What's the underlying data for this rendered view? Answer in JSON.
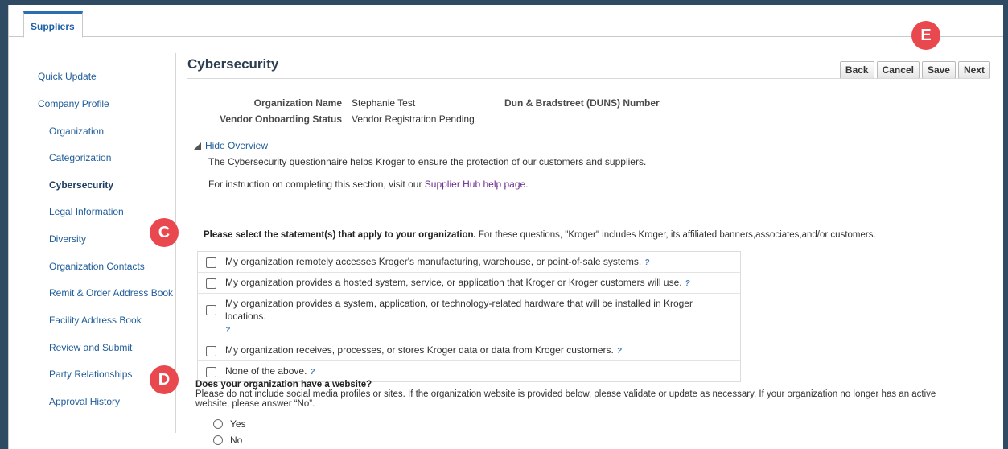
{
  "tabs": [
    {
      "label": "Suppliers"
    }
  ],
  "sidebar": {
    "items": [
      {
        "label": "Quick Update"
      },
      {
        "label": "Company Profile"
      },
      {
        "label": "Organization"
      },
      {
        "label": "Categorization"
      },
      {
        "label": "Cybersecurity"
      },
      {
        "label": "Legal Information"
      },
      {
        "label": "Diversity"
      },
      {
        "label": "Organization Contacts"
      },
      {
        "label": "Remit & Order Address Book"
      },
      {
        "label": "Facility Address Book"
      },
      {
        "label": "Review and Submit"
      },
      {
        "label": "Party Relationships"
      },
      {
        "label": "Approval History"
      }
    ],
    "active": "Cybersecurity"
  },
  "page": {
    "title": "Cybersecurity"
  },
  "buttons": {
    "back": "Back",
    "cancel": "Cancel",
    "save": "Save",
    "next": "Next"
  },
  "info": {
    "org_name_label": "Organization Name",
    "org_name_value": "Stephanie Test",
    "status_label": "Vendor Onboarding Status",
    "status_value": "Vendor Registration Pending",
    "duns_label": "Dun & Bradstreet (DUNS) Number"
  },
  "overview": {
    "toggle": "Hide Overview",
    "text1": "The Cybersecurity questionnaire helps Kroger to ensure the protection of our customers and suppliers.",
    "text2_prefix": "For instruction on completing this section, visit our ",
    "text2_link": "Supplier Hub help page",
    "text2_suffix": "."
  },
  "question": {
    "bold": "Please select the statement(s) that apply to your organization.",
    "rest": " For these questions, \"Kroger\" includes Kroger, its affiliated banners,associates,and/or customers."
  },
  "statements": [
    {
      "label": "My organization remotely accesses Kroger's manufacturing, warehouse, or point-of-sale systems."
    },
    {
      "label": "My organization provides a hosted system, service, or application that Kroger or Kroger customers will use."
    },
    {
      "label": "My organization provides a system, application, or technology-related hardware that will be installed in Kroger locations."
    },
    {
      "label": "My organization receives, processes, or stores Kroger data or data from Kroger customers."
    },
    {
      "label": "None of the above."
    }
  ],
  "website_question": {
    "title": "Does your organization have a website?",
    "desc": "Please do not include social media profiles or sites. If the organization website is provided below, please validate or update as necessary. If your organization no longer has an active website, please answer “No”.",
    "options": [
      {
        "label": "Yes"
      },
      {
        "label": "No"
      }
    ]
  },
  "markers": {
    "c": "C",
    "d": "D",
    "e": "E"
  },
  "colors": {
    "accent": "#1f5c99",
    "marker": "#e8484e",
    "link_visited": "#6d2a8f"
  }
}
